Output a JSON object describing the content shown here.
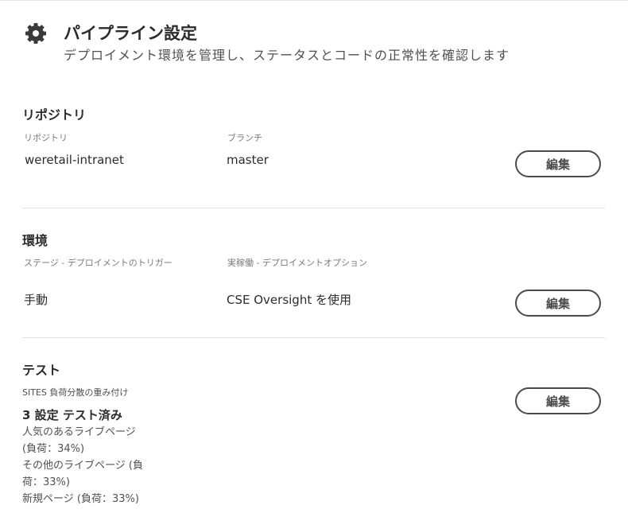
{
  "header": {
    "title": "パイプライン設定",
    "subtitle": "デプロイメント環境を管理し、ステータスとコードの正常性を確認します"
  },
  "repository": {
    "title": "リポジトリ",
    "repo_label": "リポジトリ",
    "repo_value": "weretail-intranet",
    "branch_label": "ブランチ",
    "branch_value": "master",
    "edit_label": "編集"
  },
  "environment": {
    "title": "環境",
    "stage_label": "ステージ - デプロイメントのトリガー",
    "stage_value": "手動",
    "prod_label": "実稼働 - デプロイメントオプション",
    "prod_value": "CSE Oversight を使用",
    "edit_label": "編集"
  },
  "test": {
    "title": "テスト",
    "weight_label": "SITES 負荷分散の重み付け",
    "summary": "3 設定 テスト済み",
    "lines": [
      "人気のあるライブページ",
      "(負荷：34%)",
      "その他のライブページ (負",
      "荷：33%)",
      "新規ページ (負荷：33%)"
    ],
    "edit_label": "編集"
  },
  "icons": {
    "header": "gear-icon"
  }
}
